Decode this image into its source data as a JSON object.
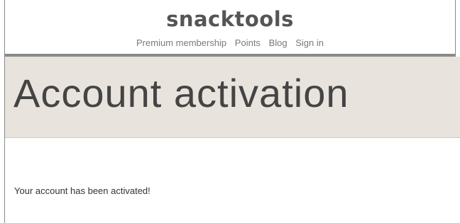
{
  "header": {
    "logo_text": "snacktools",
    "nav": {
      "premium_membership": "Premium membership",
      "points": "Points",
      "blog": "Blog",
      "sign_in": "Sign in"
    }
  },
  "banner": {
    "title": "Account activation"
  },
  "main": {
    "message": "Your account has been activated!"
  },
  "colors": {
    "banner_background": "#e8e3dc",
    "header_rule": "#8a8a8a",
    "text": "#333333"
  }
}
